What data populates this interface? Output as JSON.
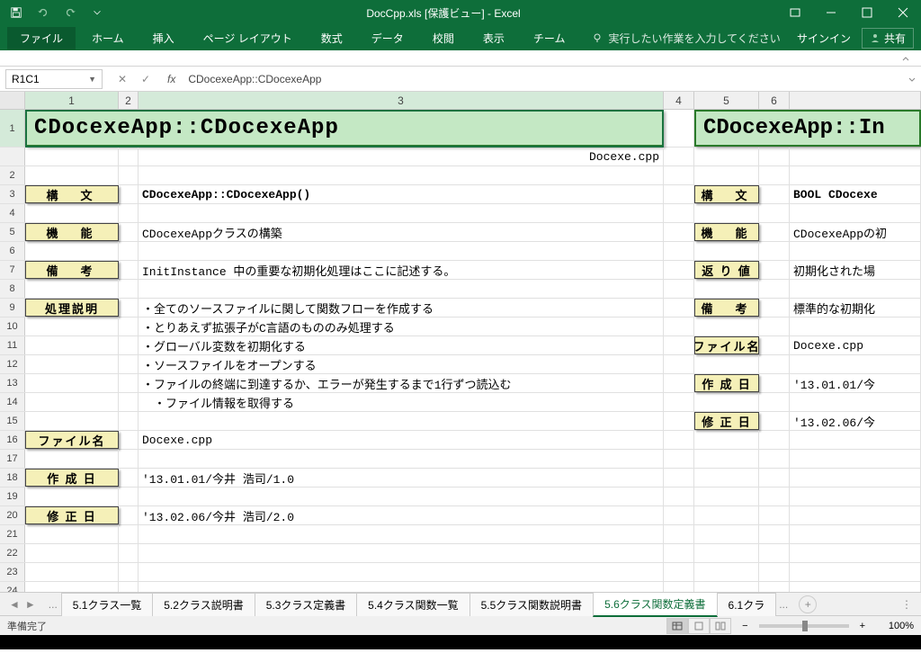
{
  "titlebar": {
    "title": "DocCpp.xls  [保護ビュー] - Excel"
  },
  "ribbon": {
    "tabs": {
      "file": "ファイル",
      "home": "ホーム",
      "insert": "挿入",
      "layout": "ページ レイアウト",
      "formula": "数式",
      "data": "データ",
      "review": "校閲",
      "view": "表示",
      "team": "チーム"
    },
    "tellme": "実行したい作業を入力してください",
    "signin": "サインイン",
    "share": "共有"
  },
  "namebox": "R1C1",
  "formula": "CDocexeApp::CDocexeApp",
  "cols": {
    "c1": "1",
    "c2": "2",
    "c3": "3",
    "c4": "4",
    "c5": "5",
    "c6": "6"
  },
  "left": {
    "title": "CDocexeApp::CDocexeApp",
    "file": "Docexe.cpp",
    "labels": {
      "syntax": "構　文",
      "func": "機　能",
      "note": "備　考",
      "proc": "処理説明",
      "fname": "ファイル名",
      "created": "作 成 日",
      "modified": "修 正 日"
    },
    "syntax": "CDocexeApp::CDocexeApp()",
    "func": "CDocexeAppクラスの構築",
    "note": "InitInstance 中の重要な初期化処理はここに記述する。",
    "proc": [
      "・全てのソースファイルに関して関数フローを作成する",
      "・とりあえず拡張子がC言語のもののみ処理する",
      "・グローバル変数を初期化する",
      "・ソースファイルをオープンする",
      "・ファイルの終端に到達するか、エラーが発生するまで1行ずつ読込む",
      "　・ファイル情報を取得する"
    ],
    "fname": "Docexe.cpp",
    "created": "'13.01.01/今井 浩司/1.0",
    "modified": "'13.02.06/今井 浩司/2.0"
  },
  "right": {
    "title": "CDocexeApp::In",
    "labels": {
      "syntax": "構　文",
      "func": "機　能",
      "ret": "返 り 値",
      "note": "備　考",
      "fname": "ファイル名",
      "created": "作 成 日",
      "modified": "修 正 日"
    },
    "syntax": "BOOL CDocexe",
    "func": "CDocexeAppの初",
    "ret": "初期化された場",
    "note": "標準的な初期化",
    "fname": "Docexe.cpp",
    "created": "'13.01.01/今",
    "modified": "'13.02.06/今"
  },
  "tabs": {
    "list": [
      "5.1クラス一覧",
      "5.2クラス説明書",
      "5.3クラス定義書",
      "5.4クラス関数一覧",
      "5.5クラス関数説明書",
      "5.6クラス関数定義書",
      "6.1クラ"
    ],
    "active": 5
  },
  "status": {
    "ready": "準備完了",
    "zoom": "100%"
  }
}
